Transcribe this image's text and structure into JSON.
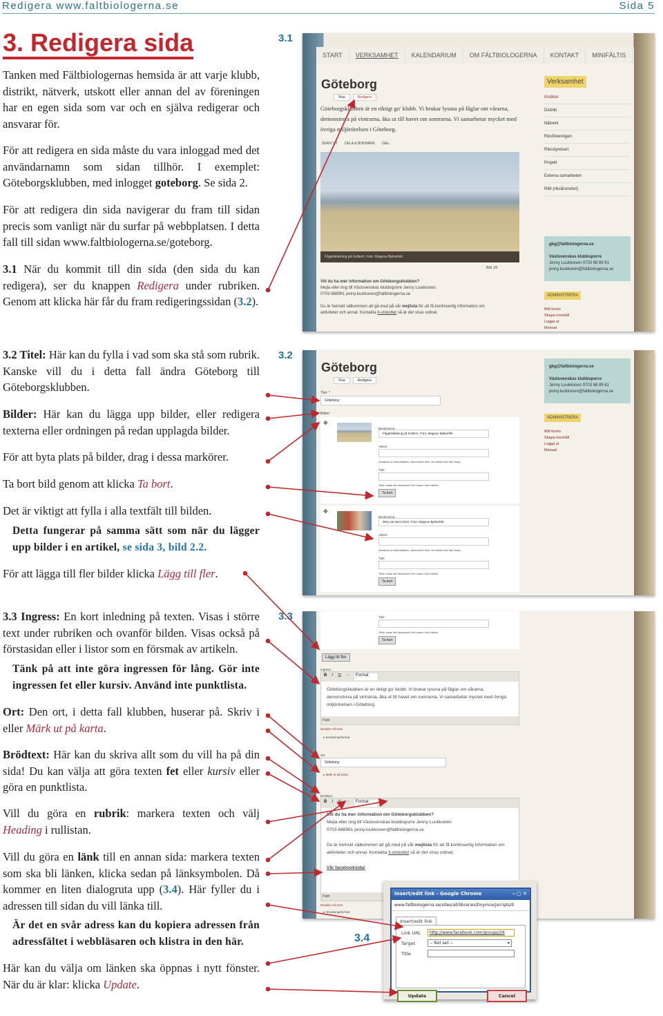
{
  "header": {
    "left": "Redigera www.faltbiologerna.se",
    "right": "Sida 5"
  },
  "title": "3. Redigera sida",
  "labels": {
    "s1": "3.1",
    "s2": "3.2",
    "s3": "3.3",
    "s4": "3.4"
  },
  "text": {
    "p1": "Tanken med Fältbiologernas hemsida är att varje klubb, distrikt, nätverk, utskott eller annan del av föreningen har en egen sida som var och en själva redigerar och ansvarar för.",
    "p2a": "För att redigera en sida måste du vara inloggad med det användarnamn som sidan tillhör. I exemplet: Göteborgsklubben, med inlogget ",
    "p2b": "goteborg",
    "p2c": ". Se sida 2.",
    "p3": "För att redigera din sida navigerar du fram till sidan precis som vanligt när du surfar på webbplatsen. I detta fall till sidan www.faltbiologerna.se/goteborg.",
    "p4a": "3.1",
    "p4b": " När du kommit till din sida (den sida du kan redigera), ser du knappen ",
    "p4c": "Redigera",
    "p4d": " under rubriken. Genom att klicka här får du fram redigeringssidan (",
    "p4e": "3.2",
    "p4f": ").",
    "p5a": "3.2 Titel:",
    "p5b": " Här kan du fylla i vad som ska stå som rubrik. Kanske vill du i detta fall ändra Göteborg till Göteborgsklubben.",
    "p6a": "Bilder:",
    "p6b": " Här kan du lägga upp bilder, eller redigera texterna eller ordningen på redan upplagda bilder.",
    "p7": "För att byta plats på bilder, drag i dessa markörer.",
    "p8a": "Ta bort bild genom att klicka ",
    "p8b": "Ta bort",
    "p8c": ".",
    "p9": "Det är viktigt att fylla i alla textfält till bilden.",
    "p10a": "Detta fungerar på samma sätt som när du lägger upp bilder i en artikel, ",
    "p10b": "se sida 3, bild 2.2.",
    "p11a": "För att lägga till fler bilder klicka ",
    "p11b": "Lägg till fler",
    "p11c": ".",
    "p12a": "3.3 Ingress:",
    "p12b": " En kort inledning på texten. Visas i större text under rubriken och ovanför bilden. Visas också på förstasidan eller i listor som en försmak av artikeln.",
    "p13": "Tänk på att inte göra ingressen för lång. Gör inte ingressen fet eller kursiv. Använd inte punktlista.",
    "p14a": "Ort:",
    "p14b": " Den ort, i detta fall klubben, huserar på. Skriv i eller ",
    "p14c": "Märk ut på karta",
    "p14d": ".",
    "p15a": "Brödtext:",
    "p15b": " Här kan du skriva allt som du vill ha på din sida! Du kan välja att göra texten ",
    "p15c": "fet",
    "p15d": " eller ",
    "p15e": "kursiv",
    "p15f": " eller göra en punktlista.",
    "p16a": "Vill du göra en ",
    "p16b": "rubrik",
    "p16c": ": markera texten och välj ",
    "p16d": "Heading",
    "p16e": " i rullistan.",
    "p17a": "Vill du göra en ",
    "p17b": "länk",
    "p17c": " till en annan sida: markera texten som ska bli länken, klicka sedan på länksymbolen. Då kommer en liten dialogruta upp (",
    "p17d": "3.4",
    "p17e": "). Här fyller du i adressen till sidan du vill länka till.",
    "p18": "Är det en svår adress kan du kopiera adressen från adressfältet i webbläsaren och klistra in den här.",
    "p19a": "Här kan du välja om länken ska öppnas i nytt fönster. När du är klar: klicka ",
    "p19b": "Update",
    "p19c": "."
  },
  "site": {
    "nav": [
      "START",
      "VERKSAMHET",
      "KALENDARIUM",
      "OM FÄLTBIOLOGERNA",
      "KONTAKT",
      "MINIFÄLTIS"
    ],
    "page_title": "Göteborg",
    "tabs": [
      "Visa",
      "Redigera"
    ],
    "intro": "Göteborgsklubben är en riktigt go' klubb. Vi brukar lyssna på fåglar om vårarna, demonstrera på vintrarna, åka ut till havet om somrarna. Vi samarbetar mycket med övriga miljörörelsen i Göteborg.",
    "actions": [
      "SKRIV UT",
      "DELA & BOKMÄRK",
      "Gilla"
    ],
    "photo_caption": "Fågelskådning på Golterö. Foto: Magnus Bjekerfelt",
    "pager": "Bild 1/5",
    "info_title": "Vill du ha mer information om Göteborgsklubben?",
    "info_1": "Mejla eller ring till Västsvenskas klubbsporre Jenny Luukkonen.",
    "info_2": "0703-688961 jenny.luukkonen@faltbiologerna.se",
    "info_3a": "Du är hemskt välkommen att gå med på vår ",
    "info_3b": "mejlista",
    "info_3c": " för att få kontinuerlig information om aktiviteter och annat. Kontakta ",
    "info_3d": "it-utskottet",
    "info_3e": " så är det strax ordnat.",
    "sidebar_title": "Verksamhet",
    "sidebar_items": [
      "Klubbar",
      "Distrikt",
      "Nätverk",
      "Riksföreningen",
      "Riksstyrelsen",
      "Projekt",
      "Externa samarbeten",
      "RiM (riksårsmötet)"
    ],
    "contact": [
      "gbg@faltbiologerna.se",
      "Västsvenskas klubbsporre",
      "Jenny Luukkonen 0703 68 89 61",
      "jenny.luukkonen@faltbiologerna.se"
    ],
    "admin_title": "ADMINISTRERA",
    "admin_links": [
      "Mitt konto",
      "Skapa innehåll",
      "Logga ut",
      "Manual"
    ]
  },
  "edit": {
    "title_label": "Titel: *",
    "title_value": "Göteborg",
    "images_label": "Bilder:",
    "desc_label": "Beskrivning:",
    "alt_label": "Alttext:",
    "alt_help": "Används av skärmläsare, sökmotorer eller om bilden inte kan visas.",
    "img_title_label": "Titel:",
    "img_title_help": "Titeln visas när besökaren för musen över bilden.",
    "desc1": "Fågelskådning på Golterö. Foto: Magnus Bjekerfelt",
    "desc2": "Wey out west 2010. Foto: Magnus Bjekerfelt",
    "remove": "Ta bort",
    "add_more": "Lägg till fler",
    "ingress_label": "Ingress:",
    "format": "Format",
    "path": "Path:",
    "disable": "Disable rich-text",
    "publish": "Inmatningsformat",
    "ort_label": "Ort:",
    "ort_value": "Göteborg",
    "map": "Märk ut på karta",
    "body_label": "Brödtext:",
    "facebook": "Vår facebooksida!"
  },
  "dialog": {
    "title": "Insert/edit link - Google Chrome",
    "url": "www.faltbiologerna.se/sites/all/libraries/tinymce/jscripts/ti",
    "tab": "Insert/edit link",
    "link_label": "Link URL",
    "link_value": "http://www.facebook.com/groups/26",
    "target_label": "Target",
    "target_value": "-- Not set --",
    "title_label": "Title",
    "update": "Update",
    "cancel": "Cancel"
  },
  "colors": {
    "accent_red": "#c1272d",
    "link_blue": "#2273a5",
    "arrow": "#c0282d"
  }
}
